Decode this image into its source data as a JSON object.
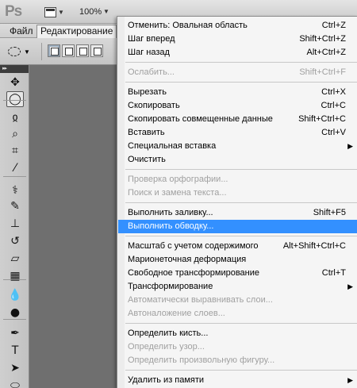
{
  "app": {
    "logo": "Ps",
    "zoom": "100%"
  },
  "menubar": {
    "items": [
      {
        "label": "Файл",
        "active": false
      },
      {
        "label": "Редактирование",
        "active": true
      }
    ]
  },
  "tools": [
    {
      "name": "move-tool-icon",
      "glyph": "✥"
    },
    {
      "name": "elliptical-marquee-tool-icon",
      "glyph": "◯"
    },
    {
      "name": "lasso-tool-icon",
      "glyph": "ჲ"
    },
    {
      "name": "quick-selection-tool-icon",
      "glyph": "⌕"
    },
    {
      "name": "crop-tool-icon",
      "glyph": "⌗"
    },
    {
      "name": "eyedropper-tool-icon",
      "glyph": "⁄"
    },
    {
      "name": "healing-brush-tool-icon",
      "glyph": "⚕"
    },
    {
      "name": "brush-tool-icon",
      "glyph": "✎"
    },
    {
      "name": "clone-stamp-tool-icon",
      "glyph": "⊥"
    },
    {
      "name": "history-brush-tool-icon",
      "glyph": "↺"
    },
    {
      "name": "eraser-tool-icon",
      "glyph": "▱"
    },
    {
      "name": "gradient-tool-icon",
      "glyph": "▦"
    },
    {
      "name": "blur-tool-icon",
      "glyph": "💧"
    },
    {
      "name": "dodge-tool-icon",
      "glyph": "●"
    },
    {
      "name": "pen-tool-icon",
      "glyph": "✒"
    },
    {
      "name": "type-tool-icon",
      "glyph": "T"
    },
    {
      "name": "path-selection-tool-icon",
      "glyph": "➤"
    },
    {
      "name": "shape-tool-icon",
      "glyph": "⬭"
    }
  ],
  "edit_menu": {
    "items": [
      {
        "label": "Отменить: Овальная область",
        "shortcut": "Ctrl+Z",
        "disabled": false
      },
      {
        "label": "Шаг вперед",
        "shortcut": "Shift+Ctrl+Z",
        "disabled": false
      },
      {
        "label": "Шаг назад",
        "shortcut": "Alt+Ctrl+Z",
        "disabled": false
      },
      {
        "sep": true
      },
      {
        "label": "Ослабить...",
        "shortcut": "Shift+Ctrl+F",
        "disabled": true
      },
      {
        "sep": true
      },
      {
        "label": "Вырезать",
        "shortcut": "Ctrl+X",
        "disabled": false
      },
      {
        "label": "Скопировать",
        "shortcut": "Ctrl+C",
        "disabled": false
      },
      {
        "label": "Скопировать совмещенные данные",
        "shortcut": "Shift+Ctrl+C",
        "disabled": false
      },
      {
        "label": "Вставить",
        "shortcut": "Ctrl+V",
        "disabled": false
      },
      {
        "label": "Специальная вставка",
        "shortcut": "",
        "submenu": true,
        "disabled": false
      },
      {
        "label": "Очистить",
        "shortcut": "",
        "disabled": false
      },
      {
        "sep": true
      },
      {
        "label": "Проверка орфографии...",
        "shortcut": "",
        "disabled": true
      },
      {
        "label": "Поиск и замена текста...",
        "shortcut": "",
        "disabled": true
      },
      {
        "sep": true
      },
      {
        "label": "Выполнить заливку...",
        "shortcut": "Shift+F5",
        "disabled": false
      },
      {
        "label": "Выполнить обводку...",
        "shortcut": "",
        "disabled": false,
        "highlighted": true
      },
      {
        "sep": true
      },
      {
        "label": "Масштаб с учетом содержимого",
        "shortcut": "Alt+Shift+Ctrl+C",
        "disabled": false
      },
      {
        "label": "Марионеточная деформация",
        "shortcut": "",
        "disabled": false
      },
      {
        "label": "Свободное трансформирование",
        "shortcut": "Ctrl+T",
        "disabled": false
      },
      {
        "label": "Трансформирование",
        "shortcut": "",
        "submenu": true,
        "disabled": false
      },
      {
        "label": "Автоматически выравнивать слои...",
        "shortcut": "",
        "disabled": true
      },
      {
        "label": "Автоналожение слоев...",
        "shortcut": "",
        "disabled": true
      },
      {
        "sep": true
      },
      {
        "label": "Определить кисть...",
        "shortcut": "",
        "disabled": false
      },
      {
        "label": "Определить узор...",
        "shortcut": "",
        "disabled": true
      },
      {
        "label": "Определить произвольную фигуру...",
        "shortcut": "",
        "disabled": true
      },
      {
        "sep": true
      },
      {
        "label": "Удалить из памяти",
        "shortcut": "",
        "submenu": true,
        "disabled": false
      }
    ]
  },
  "colors": {
    "highlight": "#3390ff",
    "disabled_text": "#a0a0a0",
    "canvas": "#6f6f6f"
  }
}
